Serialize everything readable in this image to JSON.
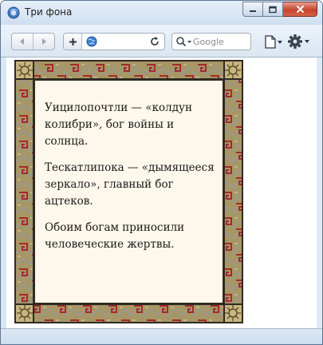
{
  "window": {
    "title": "Три фона",
    "minimize_symbol": "–",
    "maximize_symbol": "□",
    "close_symbol": "✕"
  },
  "toolbar": {
    "search_placeholder": "Google",
    "address_value": ""
  },
  "content": {
    "paragraphs": [
      "Уицилопочтли — «колдун колибри», бог войны и солнца.",
      "Тескатлипока — «дымящееся зеркало», главный бог ацтеков.",
      "Обоим богам приносили человеческие жертвы."
    ]
  },
  "colors": {
    "border_khaki": "#a79766",
    "pattern_red": "#a52a2a",
    "pattern_gray": "#9b9890",
    "inner_background": "#fef8ec",
    "frame_line": "#2f2a22"
  }
}
